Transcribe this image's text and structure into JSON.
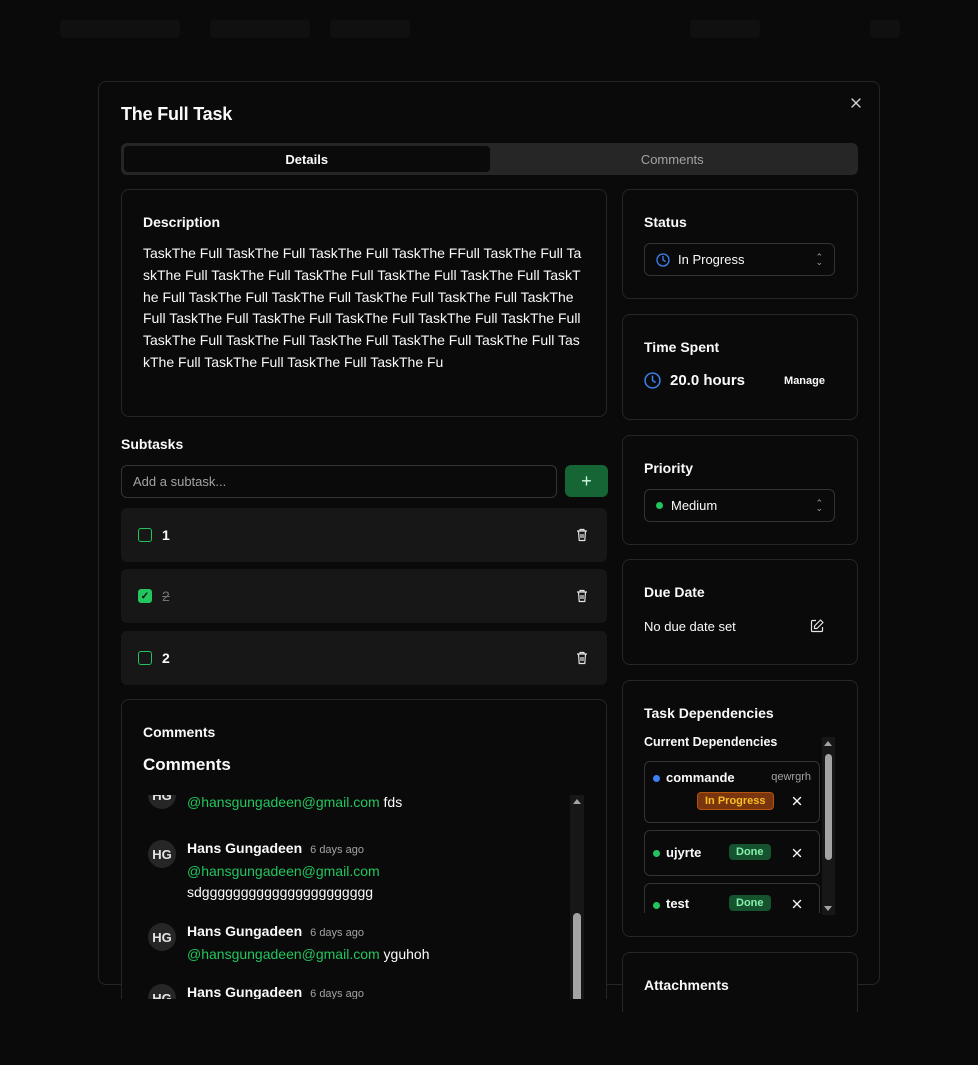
{
  "modal": {
    "title": "The Full Task",
    "tabs": [
      {
        "label": "Details"
      },
      {
        "label": "Comments"
      }
    ]
  },
  "description": {
    "title": "Description",
    "text": "TaskThe Full TaskThe Full TaskThe Full TaskThe FFull TaskThe Full TaskThe Full TaskThe Full TaskThe Full TaskThe Full TaskThe Full TaskThe Full TaskThe Full TaskThe Full TaskThe Full TaskThe Full TaskThe Full TaskThe Full TaskThe Full TaskThe Full TaskThe Full TaskThe Full TaskThe Full TaskThe Full TaskThe Full TaskThe Full TaskThe Full TaskThe Full TaskThe Full TaskThe Full TaskThe Fu"
  },
  "subtasks": {
    "title": "Subtasks",
    "placeholder": "Add a subtask...",
    "add_label": "+",
    "items": [
      {
        "label": "1",
        "done": false
      },
      {
        "label": "2",
        "done": true
      },
      {
        "label": "2",
        "done": false
      }
    ]
  },
  "comments": {
    "card_title": "Comments",
    "heading": "Comments",
    "items": [
      {
        "initials": "",
        "author": "",
        "time": "",
        "mention": "@hansgungadeen@gmail.com",
        "text": "fds"
      },
      {
        "initials": "HG",
        "author": "Hans Gungadeen",
        "time": "6 days ago",
        "mention": "@hansgungadeen@gmail.com",
        "text": "sdgggggggggggggggggggggg"
      },
      {
        "initials": "HG",
        "author": "Hans Gungadeen",
        "time": "6 days ago",
        "mention": "@hansgungadeen@gmail.com",
        "text": "yguhoh"
      },
      {
        "initials": "HG",
        "author": "Hans Gungadeen",
        "time": "6 days ago",
        "mention": "",
        "text": ""
      }
    ]
  },
  "status": {
    "title": "Status",
    "value": "In Progress",
    "icon": "clock-icon",
    "color": "#3b82f6"
  },
  "time_spent": {
    "title": "Time Spent",
    "value": "20.0 hours",
    "manage_label": "Manage"
  },
  "priority": {
    "title": "Priority",
    "value": "Medium",
    "color": "#22c55e"
  },
  "due_date": {
    "title": "Due Date",
    "value": "No due date set"
  },
  "dependencies": {
    "title": "Task Dependencies",
    "subtitle": "Current Dependencies",
    "items": [
      {
        "name": "commande",
        "project": "qewrgrh",
        "status": "In Progress",
        "dot_color": "#3b82f6"
      },
      {
        "name": "ujyrte",
        "project": "",
        "status": "Done",
        "dot_color": "#22c55e"
      },
      {
        "name": "test",
        "project": "",
        "status": "Done",
        "dot_color": "#22c55e"
      }
    ]
  },
  "attachments": {
    "title": "Attachments"
  }
}
